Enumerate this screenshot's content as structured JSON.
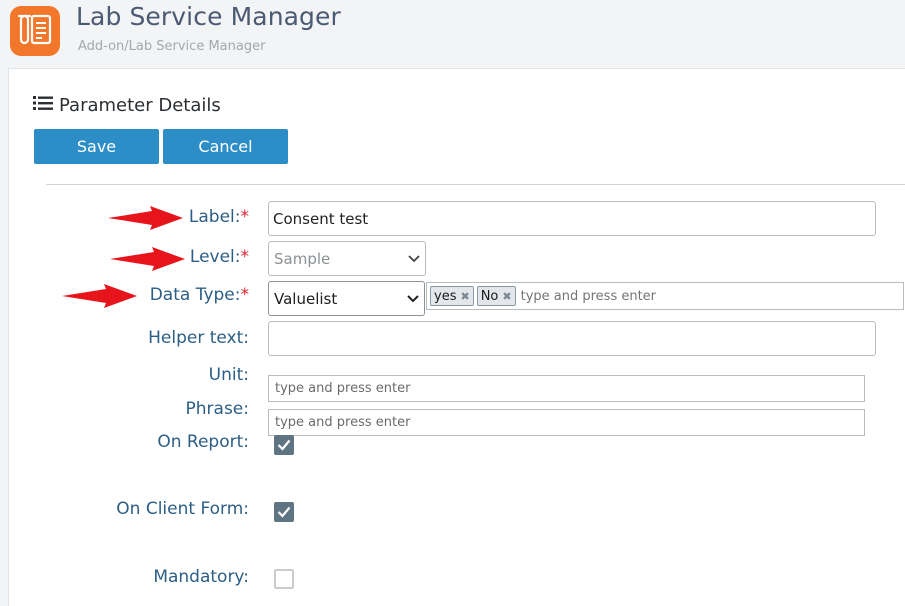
{
  "app": {
    "title": "Lab Service Manager",
    "breadcrumb": "Add-on/Lab Service Manager",
    "logo_icon": "lab-document-icon",
    "brand_color": "#f3772a"
  },
  "section": {
    "title": "Parameter Details",
    "icon": "list-icon"
  },
  "toolbar": {
    "save_label": "Save",
    "cancel_label": "Cancel",
    "button_color": "#2d8ec7"
  },
  "form": {
    "required_marker": "*",
    "label": {
      "label": "Label:",
      "value": "Consent test"
    },
    "level": {
      "label": "Level:",
      "value": "Sample"
    },
    "data_type": {
      "label": "Data Type:",
      "value": "Valuelist",
      "tags": [
        "yes",
        "No"
      ],
      "placeholder": "type and press enter"
    },
    "helper_text": {
      "label": "Helper text:",
      "value": ""
    },
    "unit": {
      "label": "Unit:",
      "placeholder": "type and press enter"
    },
    "phrase": {
      "label": "Phrase:",
      "placeholder": "type and press enter"
    },
    "on_report": {
      "label": "On Report:",
      "checked": true
    },
    "on_client_form": {
      "label": "On Client Form:",
      "checked": true
    },
    "mandatory": {
      "label": "Mandatory:",
      "checked": false
    }
  },
  "annotation_arrow_color": "#e8141b"
}
